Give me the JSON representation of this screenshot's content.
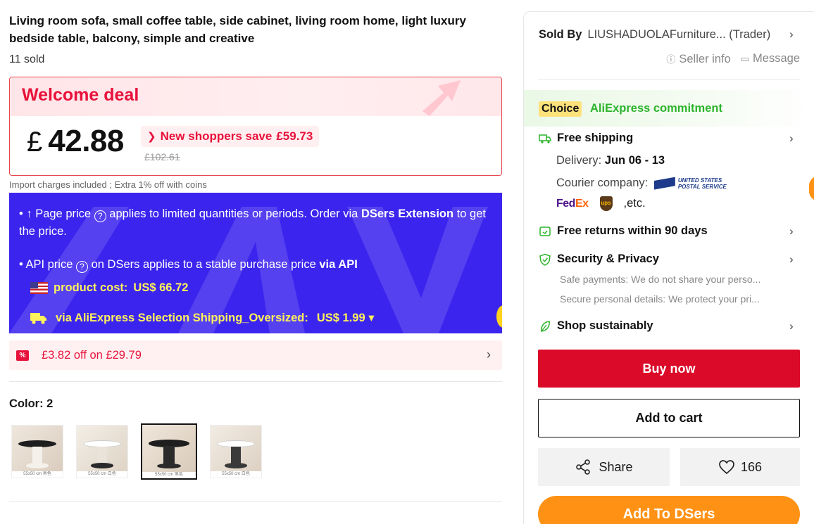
{
  "product": {
    "title": "Living room sofa, small coffee table, side cabinet, living room home, light luxury bedside table, balcony, simple and creative",
    "sold": "11 sold"
  },
  "deal": {
    "title": "Welcome deal",
    "currency": "£",
    "price": "42.88",
    "save_label": "New shoppers save",
    "save_amount": "£59.73",
    "original_price": "£102.61",
    "accent_color": "#e8113a"
  },
  "import_note": "Import charges included ; Extra 1% off with coins",
  "dsers_info": {
    "page_price_prefix": "• ↑ Page price",
    "page_price_middle": "applies to limited quantities or periods. Order via",
    "page_price_link": "DSers Extension",
    "page_price_suffix": "to get the price.",
    "api_price_prefix": "• API price",
    "api_price_middle": "on DSers applies to a stable purchase price",
    "api_price_link": "via API",
    "product_cost_label": "product cost:",
    "product_cost_value": "US$ 66.72",
    "shipping_label": "via AliExpress Selection Shipping_Oversized:",
    "shipping_value": "US$ 1.99 ▾",
    "help_glyph": "?",
    "bg_color": "#3b25ee"
  },
  "coupon": {
    "text": "£3.82 off on £29.79",
    "icon_text": "%"
  },
  "color": {
    "label": "Color: 2",
    "thumbs": [
      {
        "caption": "55x50 cm 黑色",
        "selected": false
      },
      {
        "caption": "55x50 cm 白色",
        "selected": false
      },
      {
        "caption": "55x50 cm 黑色",
        "selected": true
      },
      {
        "caption": "55x50 cm 白色",
        "selected": false
      }
    ]
  },
  "seller": {
    "sold_by_label": "Sold By",
    "store_name": "LIUSHADUOLAFurniture... (Trader)",
    "seller_info": "Seller info",
    "message": "Message"
  },
  "commitment": {
    "badge": "Choice",
    "text": "AliExpress commitment"
  },
  "shipping": {
    "title": "Free shipping",
    "delivery_label": "Delivery:",
    "delivery_dates": "Jun 06 - 13",
    "courier_label": "Courier company:",
    "usps_text_1": "UNITED STATES",
    "usps_text_2": "POSTAL SERVICE",
    "fedex_fe": "Fed",
    "fedex_ex": "Ex",
    "ups": "ups",
    "etc": ",etc."
  },
  "returns": {
    "title": "Free returns within 90 days"
  },
  "security": {
    "title": "Security & Privacy",
    "line1": "Safe payments: We do not share your perso...",
    "line2": "Secure personal details: We protect your pri..."
  },
  "sustain": {
    "title": "Shop sustainably"
  },
  "actions": {
    "buy_now": "Buy now",
    "add_to_cart": "Add to cart",
    "share": "Share",
    "wishlist_count": "166",
    "add_to_dsers": "Add To DSers"
  },
  "icons": {
    "chevron": "›",
    "bolt": "⚡",
    "info": "ⓘ",
    "message": "▭"
  }
}
